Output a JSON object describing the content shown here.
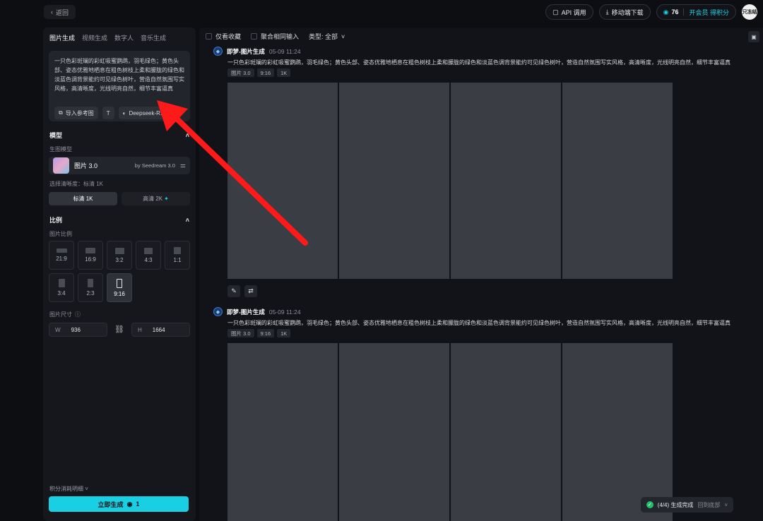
{
  "topbar": {
    "back_label": "返回",
    "api_label": "API 调用",
    "download_label": "移动端下载",
    "points": "76",
    "member_label": "开会员 得积分",
    "avatar_text": "只冻结"
  },
  "left": {
    "tabs": [
      "图片生成",
      "视频生成",
      "数字人",
      "音乐生成"
    ],
    "prompt": "一只色彩斑斓的彩虹吸蜜鹦鹉，羽毛绿色；黄色头部、姿态优雅地栖息在粗色树枝上柔和朦胧的绿色和淡蓝色调背景能约可见绿色树叶，营造自然氛围写实风格，高清晰度，光线明亮自然，细节丰富逼真",
    "actions": [
      "导入参考图",
      "T",
      "Deepseek-R1"
    ],
    "model_section": "模型",
    "model_sub": "生图模型",
    "model_name": "图片 3.0",
    "model_by": "by Seedream 3.0",
    "clarity_label": "选择清晰度：标清 1K",
    "quality": [
      "标清 1K",
      "高清 2K"
    ],
    "ratio_section": "比例",
    "ratio_sub": "图片比例",
    "ratios": [
      "21:9",
      "16:9",
      "3:2",
      "4:3",
      "1:1",
      "3:4",
      "2:3",
      "9:16"
    ],
    "size_label": "图片尺寸",
    "width_k": "W",
    "width": "936",
    "height_k": "H",
    "height": "1664",
    "credits_label": "积分消耗明细",
    "generate_label": "立即生成",
    "generate_cost": "1"
  },
  "main": {
    "filter_fav": "仅看收藏",
    "filter_merge": "聚合相同输入",
    "filter_type": "类型: 全部",
    "records": [
      {
        "name": "即梦-图片生成",
        "time": "05-09  11:24",
        "prompt": "一只色彩斑斓的彩虹吸蜜鹦鹉，羽毛绿色；黄色头部、姿态优雅地栖息在粗色树枝上柔和朦胧的绿色和淡蓝色调背景能约可见绿色树叶，营造自然氛围写实风格，高清晰度，光线明亮自然，细节丰富逼真",
        "tags": [
          "图片 3.0",
          "9:16",
          "1K"
        ]
      },
      {
        "name": "即梦-图片生成",
        "time": "05-09  11:24",
        "prompt": "一只色彩斑斓的彩虹吸蜜鹦鹉，羽毛绿色；黄色头部、姿态优雅地栖息在粗色树枝上柔和朦胧的绿色和淡蓝色调背景能约可见绿色树叶，营造自然氛围写实风格，高清晰度，光线明亮自然，细节丰富逼真",
        "tags": [
          "图片 3.0",
          "9:16",
          "1K"
        ]
      }
    ],
    "status": "(4/4) 生成完成",
    "status_action": "回到底部"
  },
  "colors": {
    "accent": "#19cfe3",
    "arrow": "#ff1a1a"
  }
}
